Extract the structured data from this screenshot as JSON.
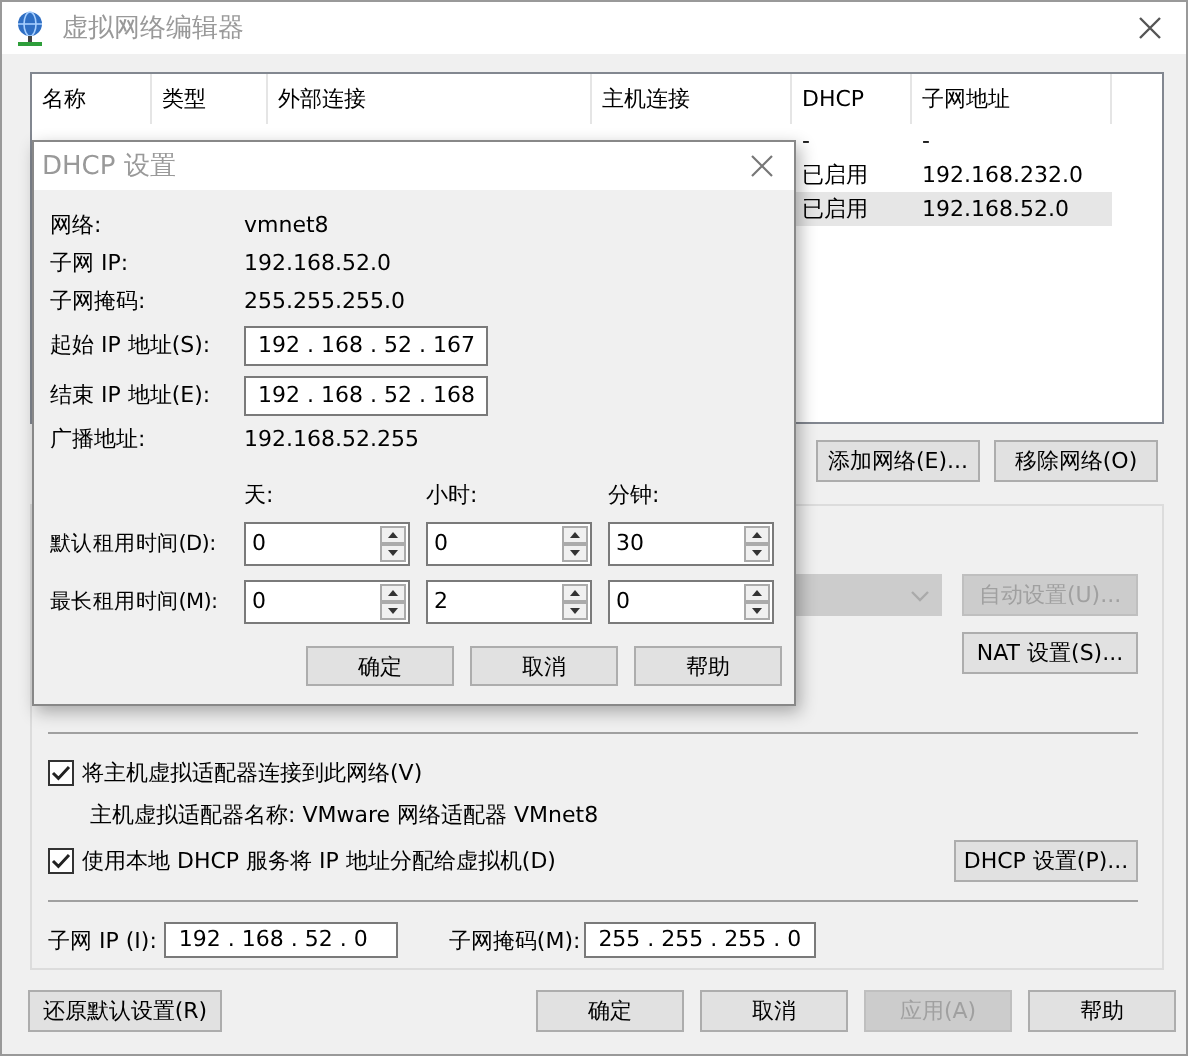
{
  "window": {
    "title": "虚拟网络编辑器"
  },
  "network_table": {
    "columns": [
      "名称",
      "类型",
      "外部连接",
      "主机连接",
      "DHCP",
      "子网地址"
    ],
    "rows": [
      {
        "dhcp": "-",
        "subnet": "-",
        "selected": false
      },
      {
        "dhcp": "已启用",
        "subnet": "192.168.232.0",
        "selected": false
      },
      {
        "dhcp": "已启用",
        "subnet": "192.168.52.0",
        "selected": true
      }
    ]
  },
  "table_buttons": [
    "添加网络(E)...",
    "移除网络(O)"
  ],
  "nat_buttons": [
    {
      "label": "自动设置(U)...",
      "disabled": true
    },
    {
      "label": "NAT 设置(S)...",
      "disabled": false
    }
  ],
  "options": [
    {
      "kind": "checkbox",
      "label": "将主机虚拟适配器连接到此网络(V)",
      "checked": true
    },
    {
      "kind": "note",
      "label": "主机虚拟适配器名称: VMware 网络适配器 VMnet8"
    },
    {
      "kind": "checkbox",
      "label": "使用本地 DHCP 服务将 IP 地址分配给虚拟机(D)",
      "checked": true,
      "button": "DHCP 设置(P)..."
    }
  ],
  "subnet": {
    "ip_label": "子网 IP (I):",
    "ip": "192 . 168 . 52 . 0",
    "mask_label": "子网掩码(M):",
    "mask": "255 . 255 . 255 . 0"
  },
  "reset_button": "还原默认设置(R)",
  "buttons": [
    {
      "label": "确定",
      "disabled": false
    },
    {
      "label": "取消",
      "disabled": false
    },
    {
      "label": "应用(A)",
      "disabled": true
    },
    {
      "label": "帮助",
      "disabled": false
    }
  ],
  "dhcp_dialog": {
    "title": "DHCP 设置",
    "info": [
      {
        "label": "网络:",
        "value": "vmnet8"
      },
      {
        "label": "子网 IP:",
        "value": "192.168.52.0"
      },
      {
        "label": "子网掩码:",
        "value": "255.255.255.0"
      }
    ],
    "ranges": [
      {
        "label": "起始 IP 地址(S):",
        "value": "192 . 168 . 52 . 167"
      },
      {
        "label": "结束 IP 地址(E):",
        "value": "192 . 168 . 52 . 168"
      }
    ],
    "broadcast": {
      "label": "广播地址:",
      "value": "192.168.52.255"
    },
    "lease_headers": [
      "天:",
      "小时:",
      "分钟:"
    ],
    "leases": [
      {
        "label": "默认租用时间(D):",
        "values": [
          "0",
          "0",
          "30"
        ]
      },
      {
        "label": "最长租用时间(M):",
        "values": [
          "0",
          "2",
          "0"
        ]
      }
    ],
    "buttons": [
      "确定",
      "取消",
      "帮助"
    ]
  }
}
